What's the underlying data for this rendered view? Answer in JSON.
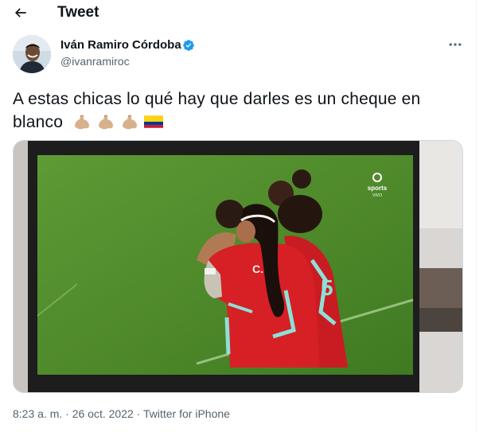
{
  "header": {
    "title": "Tweet"
  },
  "author": {
    "name": "Iván Ramiro Córdoba",
    "handle": "@ivanramiroc",
    "verified": true
  },
  "tweet": {
    "text": "A estas chicas lo qué hay que darles es un cheque en blanco",
    "emojis": [
      "flexed-biceps-emoji",
      "flexed-biceps-emoji",
      "flexed-biceps-emoji",
      "colombia-flag-emoji"
    ]
  },
  "media": {
    "broadcaster_logo": "sports",
    "broadcaster_sub": "VIVO",
    "jersey_text": "C.",
    "jersey_number": "5"
  },
  "meta": {
    "time": "8:23 a. m.",
    "separator_1": "·",
    "date": "26 oct. 2022",
    "separator_2": "·",
    "source": "Twitter for iPhone"
  },
  "colors": {
    "text": "#0f1419",
    "secondary": "#536471",
    "verified": "#1d9bf0",
    "border": "#cfd9de"
  }
}
